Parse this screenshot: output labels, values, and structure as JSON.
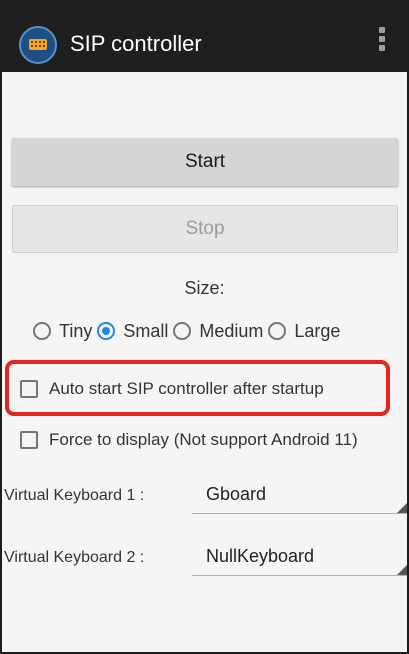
{
  "app": {
    "title": "SIP controller",
    "icon": "keyboard-icon",
    "menu_icon": "overflow-menu-icon"
  },
  "controls": {
    "start_label": "Start",
    "stop_label": "Stop",
    "stop_enabled": false
  },
  "size": {
    "label": "Size:",
    "options": [
      "Tiny",
      "Small",
      "Medium",
      "Large"
    ],
    "selected": "Small"
  },
  "options": {
    "auto_start_label": "Auto start SIP controller after startup",
    "auto_start_checked": false,
    "force_display_label": "Force to display (Not support Android 11)",
    "force_display_checked": false
  },
  "keyboards": [
    {
      "label": "Virtual Keyboard 1 :",
      "value": "Gboard"
    },
    {
      "label": "Virtual Keyboard 2 :",
      "value": "NullKeyboard"
    }
  ],
  "colors": {
    "app_bar": "#1e1e1e",
    "accent": "#1e88e5",
    "highlight": "#e52521"
  }
}
